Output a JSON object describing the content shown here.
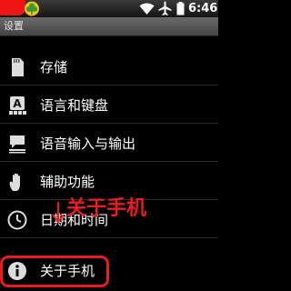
{
  "status_bar": {
    "time": "6:46",
    "icons": [
      "notification-red",
      "clover-icon",
      "wifi-icon",
      "airplane-icon",
      "battery-icon"
    ]
  },
  "title_bar": {
    "title": "设置"
  },
  "settings_list": {
    "items": [
      {
        "label": "存储",
        "icon": "sd-card-icon"
      },
      {
        "label": "语言和键盘",
        "icon": "keyboard-icon"
      },
      {
        "label": "语音输入与输出",
        "icon": "speech-bubble-icon"
      },
      {
        "label": "辅助功能",
        "icon": "hand-icon"
      },
      {
        "label": "日期和时间",
        "icon": "clock-icon"
      },
      {
        "label": "关于手机",
        "icon": "info-icon"
      }
    ]
  },
  "annotation": {
    "text": "关于手机",
    "color": "#ef1b1b"
  }
}
